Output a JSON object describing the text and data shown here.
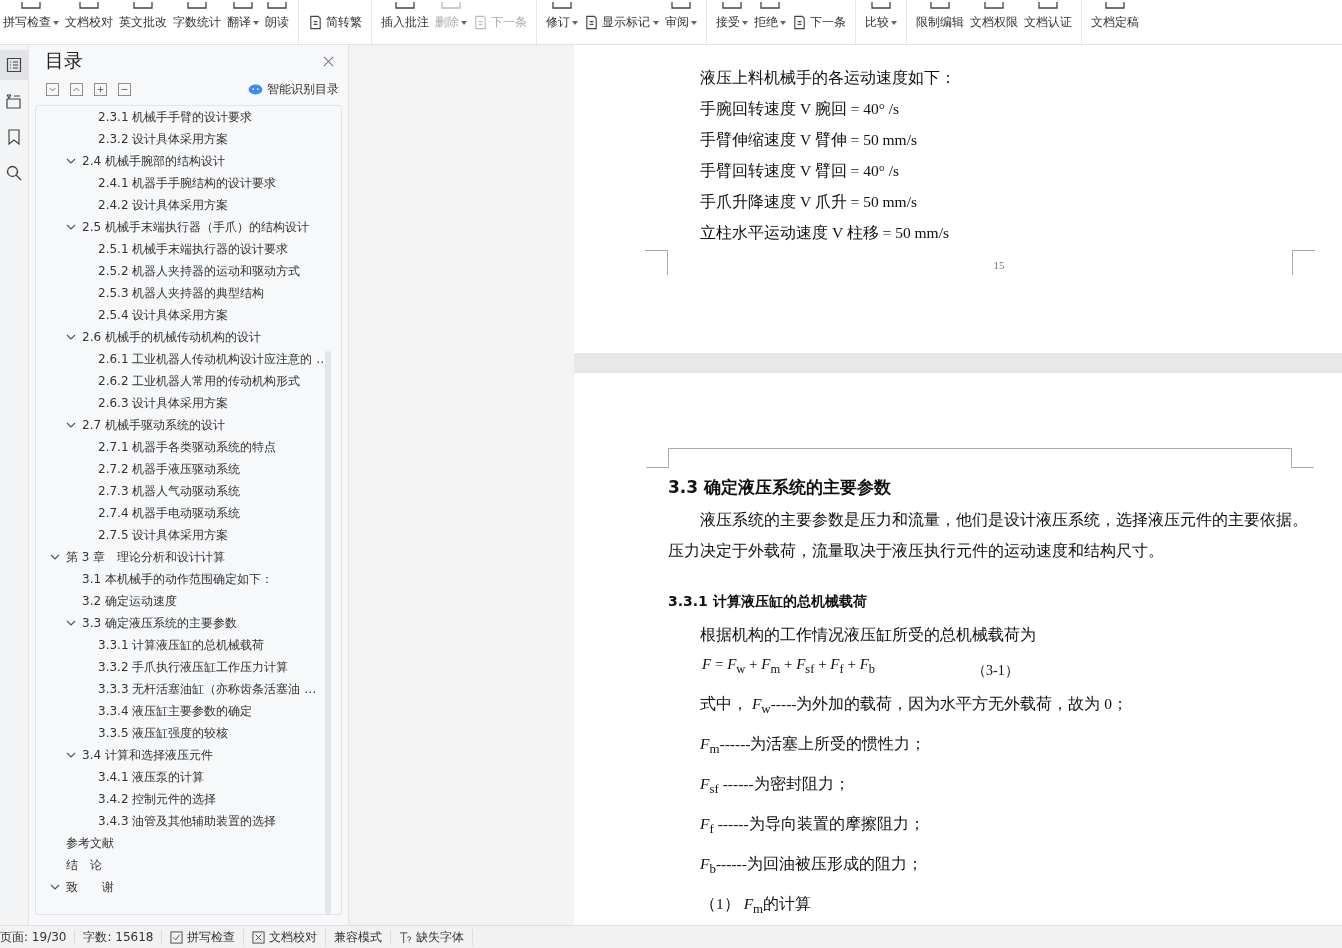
{
  "toolbar": {
    "groups": [
      {
        "items": [
          {
            "label": "拼写检查",
            "kind": "large",
            "dropdown": true,
            "disabled": false
          },
          {
            "label": "文档校对",
            "kind": "large",
            "dropdown": false,
            "disabled": false
          },
          {
            "label": "英文批改",
            "kind": "large",
            "dropdown": false,
            "disabled": false
          },
          {
            "label": "字数统计",
            "kind": "large",
            "dropdown": false,
            "disabled": false
          },
          {
            "label": "翻译",
            "kind": "large",
            "dropdown": true,
            "disabled": false
          },
          {
            "label": "朗读",
            "kind": "large",
            "dropdown": false,
            "disabled": false
          }
        ]
      },
      {
        "items": [
          {
            "label": "简转繁",
            "kind": "small",
            "dropdown": false,
            "disabled": false
          }
        ]
      },
      {
        "items": [
          {
            "label": "插入批注",
            "kind": "large",
            "dropdown": false,
            "disabled": false
          },
          {
            "label": "删除",
            "kind": "large",
            "dropdown": true,
            "disabled": true
          },
          {
            "label": "下一条",
            "kind": "small",
            "dropdown": false,
            "disabled": true
          }
        ]
      },
      {
        "items": [
          {
            "label": "修订",
            "kind": "large",
            "dropdown": true,
            "disabled": false
          },
          {
            "label": "显示标记",
            "kind": "small",
            "dropdown": true,
            "disabled": false
          },
          {
            "label": "审阅",
            "kind": "large",
            "dropdown": true,
            "disabled": false
          }
        ]
      },
      {
        "items": [
          {
            "label": "接受",
            "kind": "large",
            "dropdown": true,
            "disabled": false
          },
          {
            "label": "拒绝",
            "kind": "large",
            "dropdown": true,
            "disabled": false
          },
          {
            "label": "下一条",
            "kind": "small",
            "dropdown": false,
            "disabled": false
          }
        ]
      },
      {
        "items": [
          {
            "label": "比较",
            "kind": "large",
            "dropdown": true,
            "disabled": false
          }
        ]
      },
      {
        "items": [
          {
            "label": "限制编辑",
            "kind": "large",
            "dropdown": false,
            "disabled": false
          },
          {
            "label": "文档权限",
            "kind": "large",
            "dropdown": false,
            "disabled": false
          },
          {
            "label": "文档认证",
            "kind": "large",
            "dropdown": false,
            "disabled": false
          }
        ]
      },
      {
        "items": [
          {
            "label": "文档定稿",
            "kind": "large",
            "dropdown": false,
            "disabled": false
          }
        ]
      }
    ]
  },
  "rail": [
    {
      "kind": "toc",
      "selected": true
    },
    {
      "kind": "outline",
      "selected": false
    },
    {
      "kind": "bookmark",
      "selected": false
    },
    {
      "kind": "search",
      "selected": false
    }
  ],
  "sidebar": {
    "title": "目录",
    "smart_button": "智能识别目录",
    "items": [
      {
        "children": [
          {
            "children": [
              {
                "label": "2.3.1  机械手手臂的设计要求"
              },
              {
                "label": "2.3.2  设计具体采用方案"
              }
            ]
          },
          {
            "label": "2.4  机械手腕部的结构设计",
            "expanded": true,
            "children": [
              {
                "label": "2.4.1  机器手手腕结构的设计要求"
              },
              {
                "label": "2.4.2 设计具体采用方案"
              }
            ]
          },
          {
            "label": "2.5 机械手末端执行器（手爪）的结构设计",
            "expanded": true,
            "children": [
              {
                "label": "2.5.1 机械手末端执行器的设计要求"
              },
              {
                "label": "2.5.2 机器人夹持器的运动和驱动方式"
              },
              {
                "label": "2.5.3  机器人夹持器的典型结构"
              },
              {
                "label": "2.5.4 设计具体采用方案"
              }
            ]
          },
          {
            "label": "2.6 机械手的机械传动机构的设计",
            "expanded": true,
            "children": [
              {
                "label": "2.6.1 工业机器人传动机构设计应注意的 …"
              },
              {
                "label": "2.6.2 工业机器人常用的传动机构形式"
              },
              {
                "label": "2.6.3  设计具体采用方案"
              }
            ]
          },
          {
            "label": "2.7 机械手驱动系统的设计",
            "expanded": true,
            "children": [
              {
                "label": "2.7.1 机器手各类驱动系统的特点"
              },
              {
                "label": "2.7.2 机器手液压驱动系统"
              },
              {
                "label": "2.7.3  机器人气动驱动系统"
              },
              {
                "label": "2.7.4 机器手电动驱动系统"
              },
              {
                "label": "2.7.5 设计具体采用方案"
              }
            ]
          }
        ]
      },
      {
        "label": "第 3 章　理论分析和设计计算",
        "expanded": true,
        "children": [
          {
            "label": "3.1 本机械手的动作范围确定如下："
          },
          {
            "label": "3.2  确定运动速度"
          },
          {
            "label": "3.3 确定液压系统的主要参数",
            "expanded": true,
            "children": [
              {
                "label": "3.3.1 计算液压缸的总机械载荷"
              },
              {
                "label": "3.3.2 手爪执行液压缸工作压力计算"
              },
              {
                "label": "3.3.3  无杆活塞油缸（亦称齿条活塞油 …"
              },
              {
                "label": "3.3.4 液压缸主要参数的确定"
              },
              {
                "label": "3.3.5 液压缸强度的较核"
              }
            ]
          },
          {
            "label": "3.4 计算和选择液压元件",
            "expanded": true,
            "children": [
              {
                "label": "3.4.1 液压泵的计算"
              },
              {
                "label": "3.4.2 控制元件的选择"
              },
              {
                "label": "3.4.3 油管及其他辅助装置的选择"
              }
            ]
          }
        ]
      },
      {
        "label": "参考文献"
      },
      {
        "label": "结　论"
      },
      {
        "label": "致　　谢",
        "expanded": true
      }
    ]
  },
  "page_1": {
    "lines": [
      "液压上料机械手的各运动速度如下：",
      "手腕回转速度  V  腕回  = 40° /s",
      "手臂伸缩速度  V  臂伸  = 50 mm/s",
      "手臂回转速度  V  臂回  = 40° /s",
      "手爪升降速度  V  爪升  = 50 mm/s",
      "立柱水平运动速度  V  柱移  = 50 mm/s"
    ],
    "page_number": "15"
  },
  "page_2": {
    "blocks": [
      {
        "kind": "heading",
        "text": "3.3 确定液压系统的主要参数"
      },
      {
        "kind": "paragraph",
        "text": "液压系统的主要参数是压力和流量，他们是设计液压系统，选择液压元件的主要依据。压力决定于外载荷，流量取决于液压执行元件的运动速度和结构尺寸。"
      },
      {
        "kind": "subheading",
        "text": "3.3.1 计算液压缸的总机械载荷"
      },
      {
        "kind": "paragraph",
        "text": "根据机构的工作情况液压缸所受的总机械载荷为"
      },
      {
        "kind": "formula",
        "text": "*F* = *F*$_{w}$ + *F*$_{m}$ + *F*$_{sf}$ + *F*$_{f}$ + *F*$_{b}$",
        "number": "（3-1）"
      },
      {
        "kind": "line",
        "text": "式中，    *F*$_{w}$-----为外加的载荷，因为水平方无外载荷，故为 0；"
      },
      {
        "kind": "line",
        "text": "*F*$_{m}$------为活塞上所受的惯性力；"
      },
      {
        "kind": "line",
        "text": "*F*$_{sf}$ ------为密封阻力；"
      },
      {
        "kind": "line",
        "text": "*F*$_{f}$ ------为导向装置的摩擦阻力；"
      },
      {
        "kind": "line",
        "text": "*F*$_{b}$------为回油被压形成的阻力；"
      },
      {
        "kind": "line",
        "text": "（1） *F*$_{m}$的计算"
      }
    ]
  },
  "status_bar": [
    {
      "kind": "text",
      "text": "页面: 19/30"
    },
    {
      "kind": "text",
      "text": "字数: 15618"
    },
    {
      "kind": "check",
      "text": "拼写检查"
    },
    {
      "kind": "cross",
      "text": "文档校对"
    },
    {
      "kind": "text",
      "text": "兼容模式"
    },
    {
      "kind": "font",
      "text": "缺失字体"
    }
  ]
}
